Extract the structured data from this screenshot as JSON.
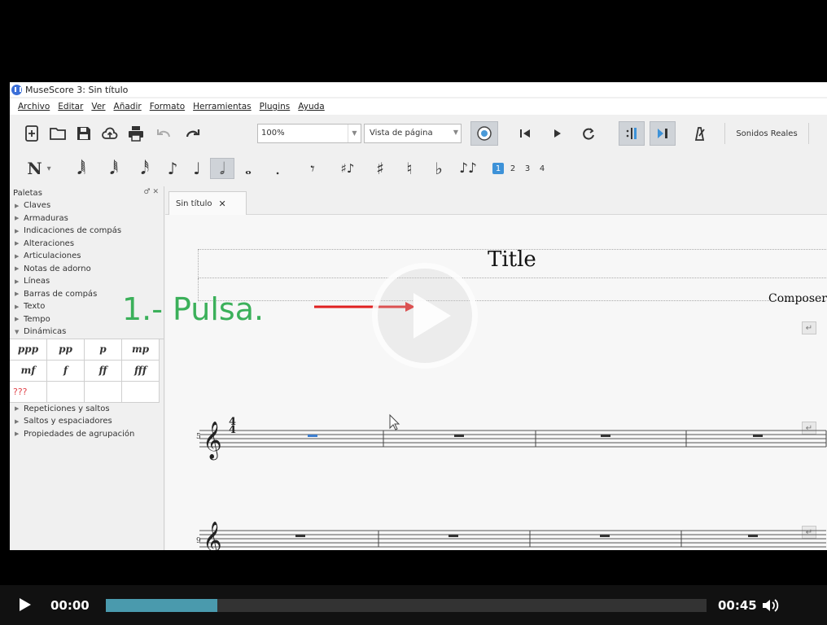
{
  "window": {
    "title": "MuseScore 3: Sin título"
  },
  "menu": [
    "Archivo",
    "Editar",
    "Ver",
    "Añadir",
    "Formato",
    "Herramientas",
    "Plugins",
    "Ayuda"
  ],
  "toolbar": {
    "zoom_value": "100%",
    "view_mode": "Vista de página",
    "sound_label": "Sonidos Reales"
  },
  "note_input": {
    "mode_label": "N",
    "voices": [
      "1",
      "2",
      "3",
      "4"
    ],
    "active_voice": "1"
  },
  "palette": {
    "title": "Paletas",
    "items_top": [
      "Claves",
      "Armaduras",
      "Indicaciones de compás",
      "Alteraciones",
      "Articulaciones",
      "Notas de adorno",
      "Líneas",
      "Barras de compás",
      "Texto",
      "Tempo",
      "Dinámicas"
    ],
    "dynamics": [
      "ppp",
      "pp",
      "p",
      "mp",
      "mf",
      "f",
      "ff",
      "fff",
      "???",
      "",
      "",
      ""
    ],
    "items_bottom": [
      "Repeticiones y saltos",
      "Saltos y espaciadores",
      "Propiedades de agrupación"
    ]
  },
  "score": {
    "tab_label": "Sin título",
    "title": "Title",
    "composer": "Composer",
    "measure_numbers": [
      "5",
      "9"
    ],
    "time_signature": {
      "top": "4",
      "bottom": "4"
    }
  },
  "annotation": {
    "text": "1.- Pulsa."
  },
  "player": {
    "current_time": "00:00",
    "duration": "00:45",
    "buffered_fraction": 0.186,
    "played_fraction": 0
  },
  "colors": {
    "annotation_green": "#3bb05a",
    "arrow_red": "#e02020",
    "buffer_teal": "#4a9aad",
    "active_voice_blue": "#3d92d8"
  }
}
